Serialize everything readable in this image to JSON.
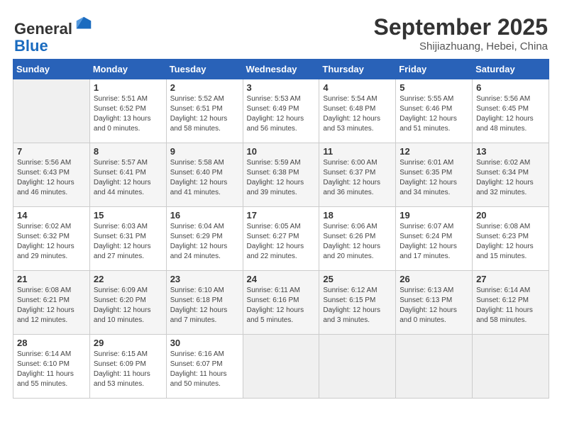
{
  "header": {
    "logo_line1": "General",
    "logo_line2": "Blue",
    "month_year": "September 2025",
    "location": "Shijiazhuang, Hebei, China"
  },
  "weekdays": [
    "Sunday",
    "Monday",
    "Tuesday",
    "Wednesday",
    "Thursday",
    "Friday",
    "Saturday"
  ],
  "weeks": [
    [
      {
        "day": "",
        "info": ""
      },
      {
        "day": "1",
        "info": "Sunrise: 5:51 AM\nSunset: 6:52 PM\nDaylight: 13 hours\nand 0 minutes."
      },
      {
        "day": "2",
        "info": "Sunrise: 5:52 AM\nSunset: 6:51 PM\nDaylight: 12 hours\nand 58 minutes."
      },
      {
        "day": "3",
        "info": "Sunrise: 5:53 AM\nSunset: 6:49 PM\nDaylight: 12 hours\nand 56 minutes."
      },
      {
        "day": "4",
        "info": "Sunrise: 5:54 AM\nSunset: 6:48 PM\nDaylight: 12 hours\nand 53 minutes."
      },
      {
        "day": "5",
        "info": "Sunrise: 5:55 AM\nSunset: 6:46 PM\nDaylight: 12 hours\nand 51 minutes."
      },
      {
        "day": "6",
        "info": "Sunrise: 5:56 AM\nSunset: 6:45 PM\nDaylight: 12 hours\nand 48 minutes."
      }
    ],
    [
      {
        "day": "7",
        "info": "Sunrise: 5:56 AM\nSunset: 6:43 PM\nDaylight: 12 hours\nand 46 minutes."
      },
      {
        "day": "8",
        "info": "Sunrise: 5:57 AM\nSunset: 6:41 PM\nDaylight: 12 hours\nand 44 minutes."
      },
      {
        "day": "9",
        "info": "Sunrise: 5:58 AM\nSunset: 6:40 PM\nDaylight: 12 hours\nand 41 minutes."
      },
      {
        "day": "10",
        "info": "Sunrise: 5:59 AM\nSunset: 6:38 PM\nDaylight: 12 hours\nand 39 minutes."
      },
      {
        "day": "11",
        "info": "Sunrise: 6:00 AM\nSunset: 6:37 PM\nDaylight: 12 hours\nand 36 minutes."
      },
      {
        "day": "12",
        "info": "Sunrise: 6:01 AM\nSunset: 6:35 PM\nDaylight: 12 hours\nand 34 minutes."
      },
      {
        "day": "13",
        "info": "Sunrise: 6:02 AM\nSunset: 6:34 PM\nDaylight: 12 hours\nand 32 minutes."
      }
    ],
    [
      {
        "day": "14",
        "info": "Sunrise: 6:02 AM\nSunset: 6:32 PM\nDaylight: 12 hours\nand 29 minutes."
      },
      {
        "day": "15",
        "info": "Sunrise: 6:03 AM\nSunset: 6:31 PM\nDaylight: 12 hours\nand 27 minutes."
      },
      {
        "day": "16",
        "info": "Sunrise: 6:04 AM\nSunset: 6:29 PM\nDaylight: 12 hours\nand 24 minutes."
      },
      {
        "day": "17",
        "info": "Sunrise: 6:05 AM\nSunset: 6:27 PM\nDaylight: 12 hours\nand 22 minutes."
      },
      {
        "day": "18",
        "info": "Sunrise: 6:06 AM\nSunset: 6:26 PM\nDaylight: 12 hours\nand 20 minutes."
      },
      {
        "day": "19",
        "info": "Sunrise: 6:07 AM\nSunset: 6:24 PM\nDaylight: 12 hours\nand 17 minutes."
      },
      {
        "day": "20",
        "info": "Sunrise: 6:08 AM\nSunset: 6:23 PM\nDaylight: 12 hours\nand 15 minutes."
      }
    ],
    [
      {
        "day": "21",
        "info": "Sunrise: 6:08 AM\nSunset: 6:21 PM\nDaylight: 12 hours\nand 12 minutes."
      },
      {
        "day": "22",
        "info": "Sunrise: 6:09 AM\nSunset: 6:20 PM\nDaylight: 12 hours\nand 10 minutes."
      },
      {
        "day": "23",
        "info": "Sunrise: 6:10 AM\nSunset: 6:18 PM\nDaylight: 12 hours\nand 7 minutes."
      },
      {
        "day": "24",
        "info": "Sunrise: 6:11 AM\nSunset: 6:16 PM\nDaylight: 12 hours\nand 5 minutes."
      },
      {
        "day": "25",
        "info": "Sunrise: 6:12 AM\nSunset: 6:15 PM\nDaylight: 12 hours\nand 3 minutes."
      },
      {
        "day": "26",
        "info": "Sunrise: 6:13 AM\nSunset: 6:13 PM\nDaylight: 12 hours\nand 0 minutes."
      },
      {
        "day": "27",
        "info": "Sunrise: 6:14 AM\nSunset: 6:12 PM\nDaylight: 11 hours\nand 58 minutes."
      }
    ],
    [
      {
        "day": "28",
        "info": "Sunrise: 6:14 AM\nSunset: 6:10 PM\nDaylight: 11 hours\nand 55 minutes."
      },
      {
        "day": "29",
        "info": "Sunrise: 6:15 AM\nSunset: 6:09 PM\nDaylight: 11 hours\nand 53 minutes."
      },
      {
        "day": "30",
        "info": "Sunrise: 6:16 AM\nSunset: 6:07 PM\nDaylight: 11 hours\nand 50 minutes."
      },
      {
        "day": "",
        "info": ""
      },
      {
        "day": "",
        "info": ""
      },
      {
        "day": "",
        "info": ""
      },
      {
        "day": "",
        "info": ""
      }
    ]
  ]
}
